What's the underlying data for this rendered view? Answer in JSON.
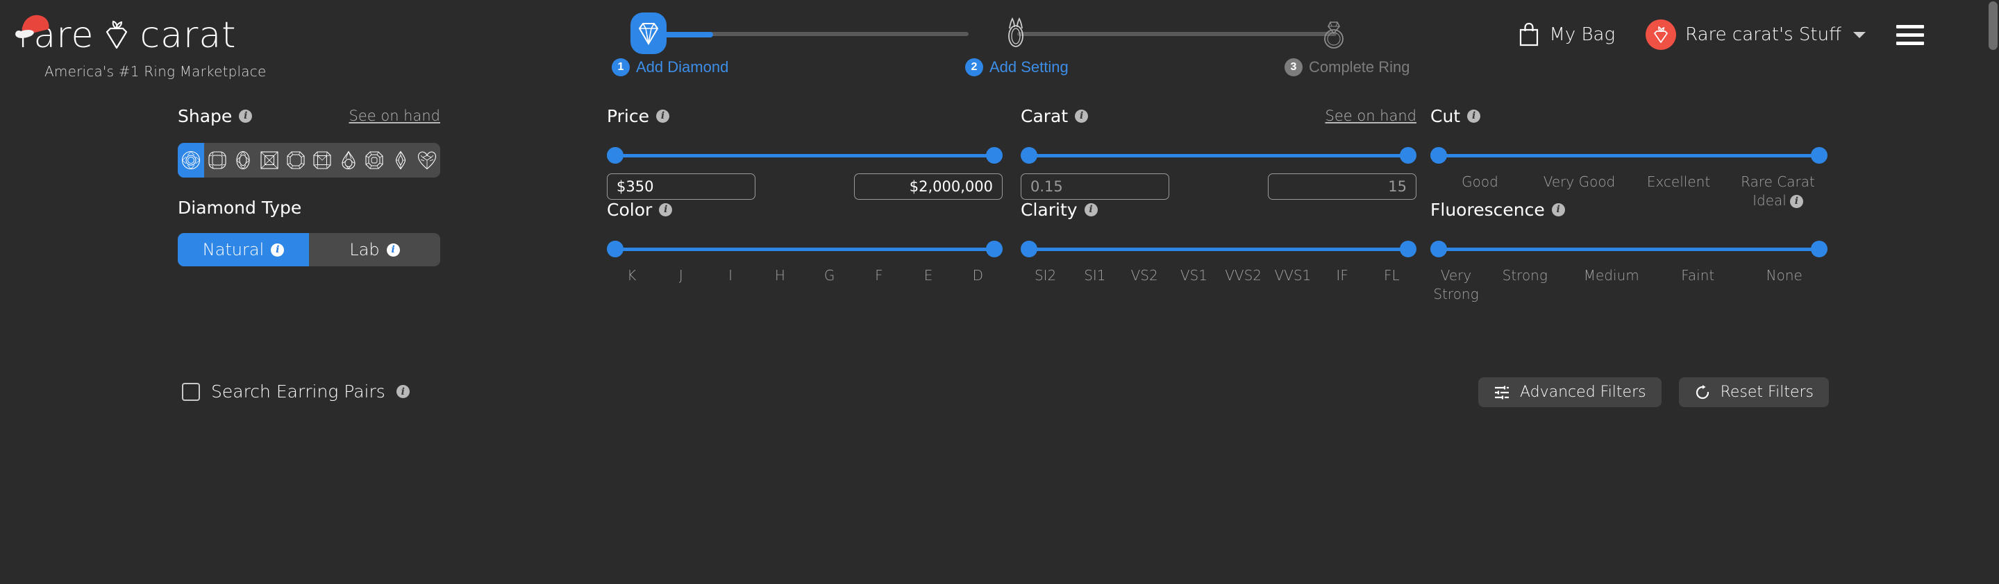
{
  "brand": {
    "name": "rare carat",
    "name_part1": "rare",
    "name_part2": "carat",
    "tagline": "America's #1 Ring Marketplace"
  },
  "stepper": {
    "steps": [
      {
        "num": "1",
        "label": "Add Diamond",
        "state": "active",
        "icon": "diamond-icon"
      },
      {
        "num": "2",
        "label": "Add Setting",
        "state": "active",
        "icon": "setting-icon"
      },
      {
        "num": "3",
        "label": "Complete Ring",
        "state": "inactive",
        "icon": "ring-icon"
      }
    ]
  },
  "header": {
    "bag_label": "My Bag",
    "account_label": "Rare carat's Stuff",
    "bag_icon": "shopping-bag-icon",
    "avatar_icon": "rare-carat-gem-icon",
    "caret_icon": "chevron-down-icon",
    "menu_icon": "hamburger-menu-icon"
  },
  "filters": {
    "shape": {
      "title": "Shape",
      "see_on_hand": "See on hand",
      "options": [
        {
          "name": "round",
          "selected": true
        },
        {
          "name": "cushion",
          "selected": false
        },
        {
          "name": "oval",
          "selected": false
        },
        {
          "name": "princess",
          "selected": false
        },
        {
          "name": "emerald",
          "selected": false
        },
        {
          "name": "radiant",
          "selected": false
        },
        {
          "name": "pear",
          "selected": false
        },
        {
          "name": "asscher",
          "selected": false
        },
        {
          "name": "marquise",
          "selected": false
        },
        {
          "name": "heart",
          "selected": false
        }
      ]
    },
    "price": {
      "title": "Price",
      "min_value": "$350",
      "max_value": "$2,000,000"
    },
    "carat": {
      "title": "Carat",
      "see_on_hand": "See on hand",
      "min_value": "0.15",
      "max_value": "15"
    },
    "cut": {
      "title": "Cut",
      "ticks": [
        "Good",
        "Very Good",
        "Excellent",
        "Rare Carat Ideal"
      ]
    },
    "diamond_type": {
      "title": "Diamond Type",
      "options": [
        {
          "label": "Natural",
          "selected": true
        },
        {
          "label": "Lab",
          "selected": false
        }
      ]
    },
    "color": {
      "title": "Color",
      "ticks": [
        "K",
        "J",
        "I",
        "H",
        "G",
        "F",
        "E",
        "D"
      ]
    },
    "clarity": {
      "title": "Clarity",
      "ticks": [
        "SI2",
        "SI1",
        "VS2",
        "VS1",
        "VVS2",
        "VVS1",
        "IF",
        "FL"
      ]
    },
    "fluorescence": {
      "title": "Fluorescence",
      "ticks": [
        "Very Strong",
        "Strong",
        "Medium",
        "Faint",
        "None"
      ]
    },
    "earring_pairs": {
      "label": "Search Earring Pairs",
      "checked": false
    },
    "buttons": {
      "advanced": "Advanced Filters",
      "reset": "Reset Filters",
      "advanced_icon": "sliders-icon",
      "reset_icon": "refresh-icon"
    }
  },
  "colors": {
    "background": "#2b2b2b",
    "accent_blue": "#2e86e6",
    "avatar_red": "#ef5244",
    "muted_text": "#a3a3a3",
    "control_gray": "#4a4a4a"
  }
}
